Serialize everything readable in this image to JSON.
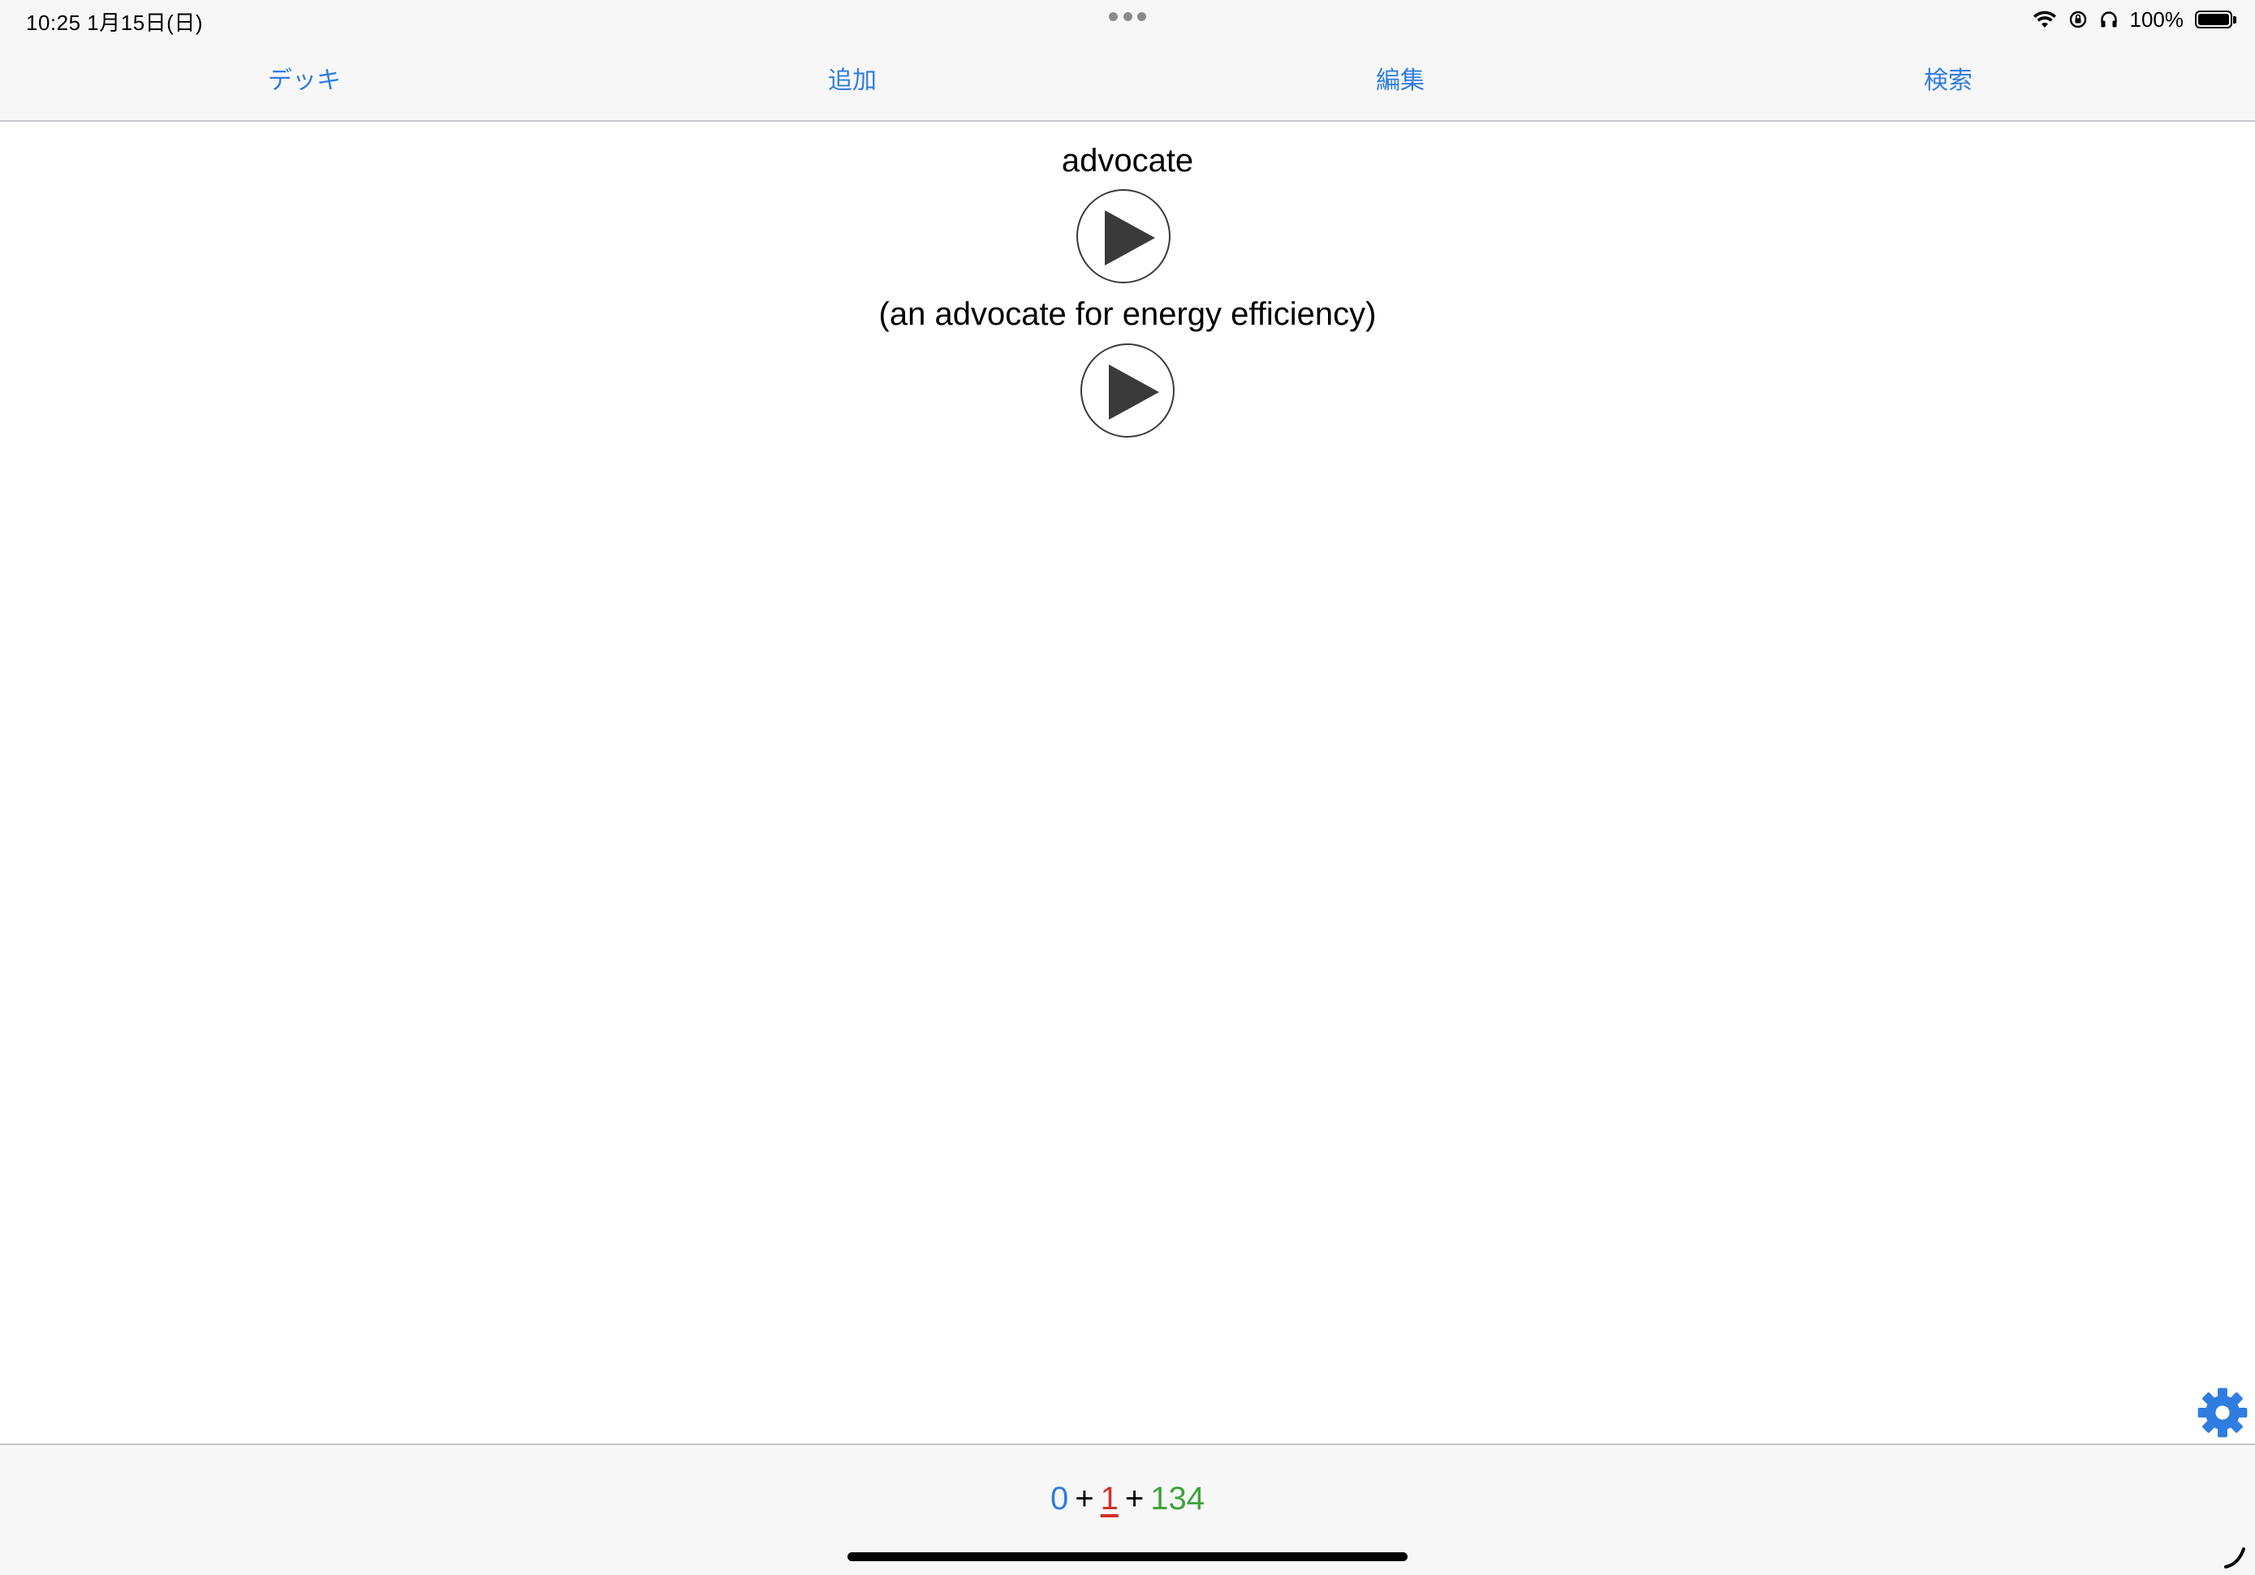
{
  "status_bar": {
    "time_date": "10:25   1月15日(日)",
    "battery_percent": "100%",
    "battery_level": 1.0,
    "icons": [
      "wifi-icon",
      "orientation-lock-icon",
      "headphones-icon",
      "battery-icon"
    ]
  },
  "nav": {
    "tabs": [
      {
        "label": "デッキ"
      },
      {
        "label": "追加"
      },
      {
        "label": "編集"
      },
      {
        "label": "検索"
      }
    ]
  },
  "card": {
    "word": "advocate",
    "sentence": "(an advocate for energy efficiency)",
    "play_icon": "play-icon"
  },
  "counts": {
    "new": "0",
    "learning": "1",
    "review": "134",
    "separator": "+"
  },
  "colors": {
    "accent": "#2f7de1",
    "new": "#2f7de1",
    "learning": "#d0312d",
    "review": "#3ea33b",
    "gear": "#2f7de1"
  },
  "icons": {
    "settings": "gear-icon",
    "corner": "curve-icon"
  }
}
